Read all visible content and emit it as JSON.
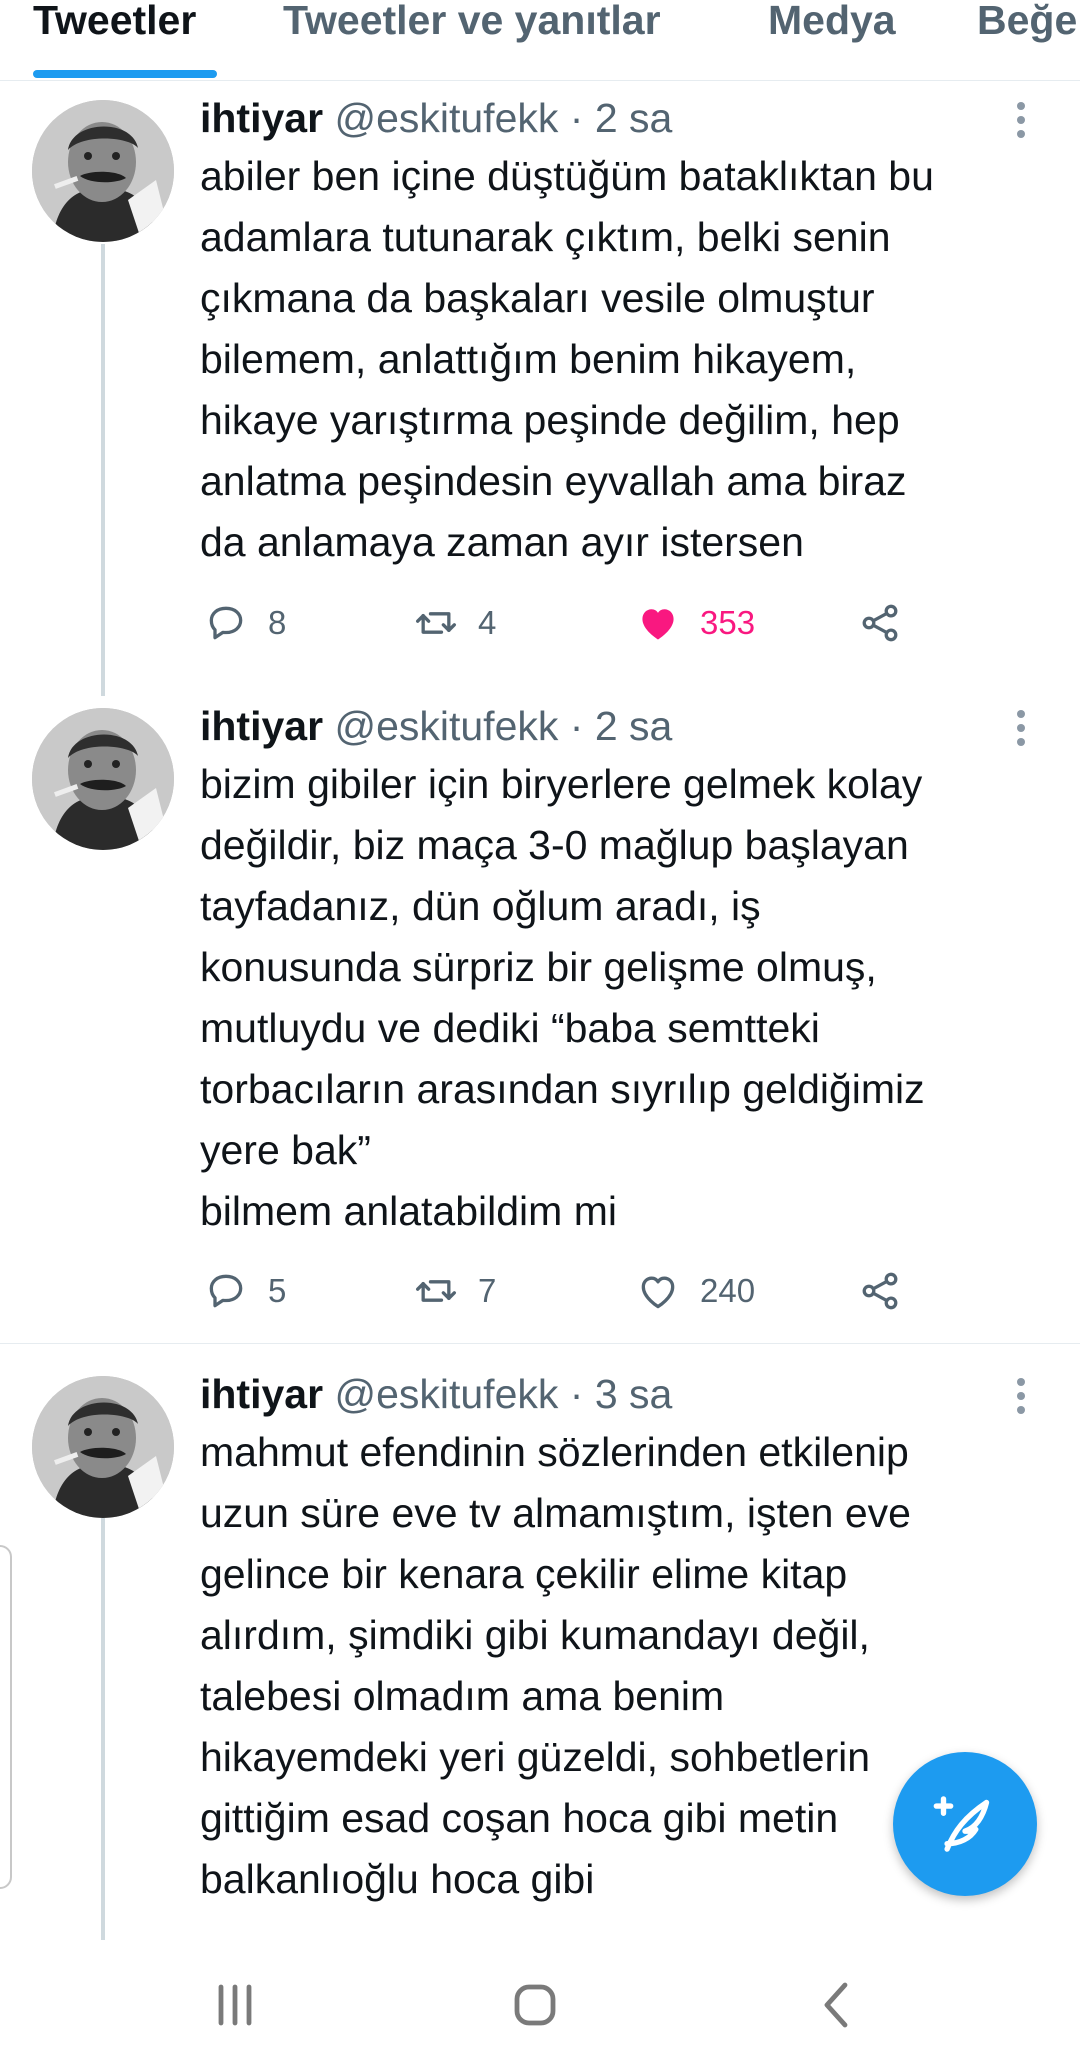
{
  "tabs": [
    {
      "label": "Tweetler",
      "active": true
    },
    {
      "label": "Tweetler ve yanıtlar",
      "active": false
    },
    {
      "label": "Medya",
      "active": false
    },
    {
      "label": "Beğe",
      "active": false
    }
  ],
  "tweets": [
    {
      "name": "ihtiyar",
      "handle": "@eskitufekk",
      "separator": "·",
      "time": "2 sa",
      "text": "abiler ben içine düştüğüm bataklıktan bu\nadamlara tutunarak çıktım, belki senin\nçıkmana da başkaları vesile olmuştur\nbilemem, anlattığım benim hikayem,\nhikaye yarıştırma peşinde değilim, hep\nanlatma peşindesin eyvallah ama biraz\nda anlamaya zaman ayır istersen",
      "replies": "8",
      "retweets": "4",
      "likes": "353",
      "liked": true
    },
    {
      "name": "ihtiyar",
      "handle": "@eskitufekk",
      "separator": "·",
      "time": "2 sa",
      "text": "bizim gibiler için biryerlere gelmek kolay\ndeğildir, biz maça 3-0 mağlup başlayan\ntayfadanız, dün oğlum aradı, iş\nkonusunda sürpriz bir gelişme olmuş,\nmutluydu ve dediki “baba semtteki\ntorbacıların arasından sıyrılıp geldiğimiz\nyere bak”\nbilmem anlatabildim mi",
      "replies": "5",
      "retweets": "7",
      "likes": "240",
      "liked": false
    },
    {
      "name": "ihtiyar",
      "handle": "@eskitufekk",
      "separator": "·",
      "time": "3 sa",
      "text": "mahmut efendinin sözlerinden etkilenip\nuzun süre eve tv almamıştım, işten eve\ngelince bir kenara çekilir elime kitap\nalırdım, şimdiki gibi kumandayı değil,\ntalebesi olmadım ama benim\nhikayemdeki yeri güzeldi, sohbetlerin\ngittiğim esad coşan hoca gibi metin\nbalkanlıoğlu hoca gibi"
    }
  ],
  "icons": {
    "reply": "reply-icon",
    "retweet": "retweet-icon",
    "like": "heart-icon",
    "share": "share-icon",
    "more": "more-vertical-icon",
    "compose": "compose-tweet-icon"
  },
  "colors": {
    "accent": "#1d9bf0",
    "like": "#f91880",
    "secondary_text": "#536471"
  },
  "nav": {
    "recent": "recent-apps-icon",
    "home": "home-icon",
    "back": "back-icon"
  }
}
